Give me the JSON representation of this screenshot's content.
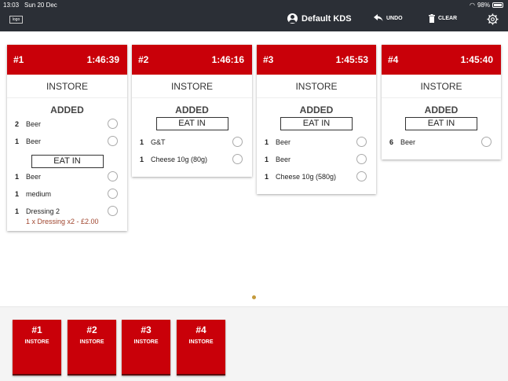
{
  "status": {
    "time": "13:03",
    "date": "Sun 20 Dec",
    "battery": "98%"
  },
  "header": {
    "logo_text": "logo",
    "kds_name": "Default KDS",
    "undo_label": "UNDO",
    "clear_label": "CLEAR"
  },
  "orders": [
    {
      "number": "#1",
      "timer": "1:46:39",
      "type": "INSTORE",
      "section": "ADDED",
      "items_a": [
        {
          "qty": "2",
          "name": "Beer"
        },
        {
          "qty": "1",
          "name": "Beer"
        }
      ],
      "subsection": "EAT IN",
      "items_b": [
        {
          "qty": "1",
          "name": "Beer"
        },
        {
          "qty": "1",
          "name": "medium"
        },
        {
          "qty": "1",
          "name": "Dressing 2"
        }
      ],
      "modifier": "1 x Dressing x2 - £2.00"
    },
    {
      "number": "#2",
      "timer": "1:46:16",
      "type": "INSTORE",
      "section": "ADDED",
      "subsection": "EAT IN",
      "items": [
        {
          "qty": "1",
          "name": "G&T"
        },
        {
          "qty": "1",
          "name": "Cheese 10g (80g)"
        }
      ]
    },
    {
      "number": "#3",
      "timer": "1:45:53",
      "type": "INSTORE",
      "section": "ADDED",
      "subsection": "EAT IN",
      "items": [
        {
          "qty": "1",
          "name": "Beer"
        },
        {
          "qty": "1",
          "name": "Beer"
        },
        {
          "qty": "1",
          "name": "Cheese 10g (580g)"
        }
      ]
    },
    {
      "number": "#4",
      "timer": "1:45:40",
      "type": "INSTORE",
      "section": "ADDED",
      "subsection": "EAT IN",
      "items": [
        {
          "qty": "6",
          "name": "Beer"
        }
      ]
    }
  ],
  "tiles": [
    {
      "number": "#1",
      "type": "INSTORE"
    },
    {
      "number": "#2",
      "type": "INSTORE"
    },
    {
      "number": "#3",
      "type": "INSTORE"
    },
    {
      "number": "#4",
      "type": "INSTORE"
    }
  ],
  "colors": {
    "accent": "#c90009",
    "topbar": "#2b2f36",
    "modifier": "#a0462f"
  },
  "icons": [
    "user-icon",
    "undo-icon",
    "trash-icon",
    "gear-icon",
    "wifi-icon",
    "battery-icon"
  ]
}
